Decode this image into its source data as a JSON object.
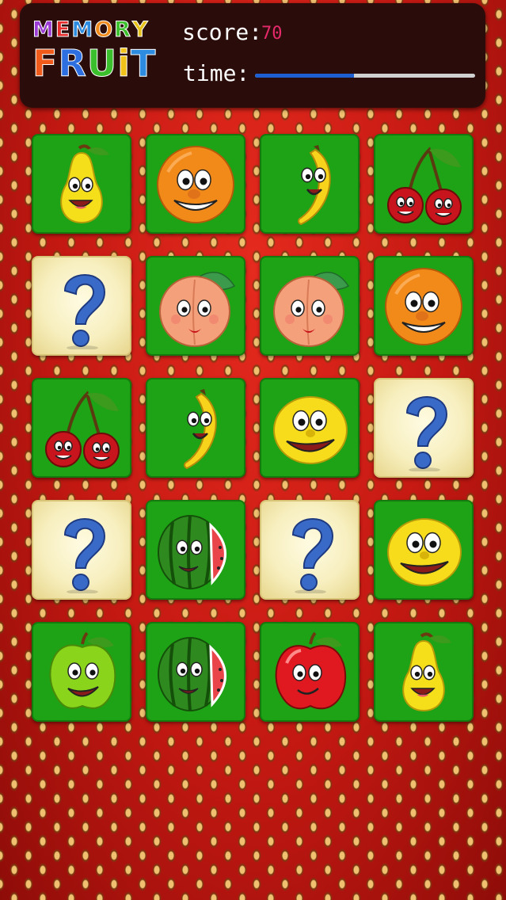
{
  "game": {
    "logo_top_letters": [
      {
        "ch": "M",
        "color": "#9b3ad4"
      },
      {
        "ch": "E",
        "color": "#e62e2e"
      },
      {
        "ch": "M",
        "color": "#2d8be0"
      },
      {
        "ch": "O",
        "color": "#f08a1a"
      },
      {
        "ch": "R",
        "color": "#3cbf2c"
      },
      {
        "ch": "Y",
        "color": "#e6c21a"
      }
    ],
    "logo_bottom_letters": [
      {
        "ch": "F",
        "color": "#f05a1a"
      },
      {
        "ch": "R",
        "color": "#2d6fe0"
      },
      {
        "ch": "U",
        "color": "#3cbf2c"
      },
      {
        "ch": "i",
        "color": "#f0c21a"
      },
      {
        "ch": "T",
        "color": "#2d8be0"
      }
    ]
  },
  "hud": {
    "score_label": "score:",
    "score_value": "70",
    "time_label": "time:",
    "time_remaining": 0.45,
    "time_color": "#1d5fd0"
  },
  "board": {
    "rows": 5,
    "cols": 4,
    "cards": [
      {
        "state": "revealed",
        "fruit": "pear"
      },
      {
        "state": "revealed",
        "fruit": "orange"
      },
      {
        "state": "revealed",
        "fruit": "banana"
      },
      {
        "state": "revealed",
        "fruit": "cherries"
      },
      {
        "state": "hidden",
        "fruit": "question-mark"
      },
      {
        "state": "revealed",
        "fruit": "peach"
      },
      {
        "state": "revealed",
        "fruit": "peach"
      },
      {
        "state": "revealed",
        "fruit": "orange"
      },
      {
        "state": "revealed",
        "fruit": "cherries"
      },
      {
        "state": "revealed",
        "fruit": "banana"
      },
      {
        "state": "revealed",
        "fruit": "lemon"
      },
      {
        "state": "hidden",
        "fruit": "question-mark"
      },
      {
        "state": "hidden",
        "fruit": "question-mark"
      },
      {
        "state": "revealed",
        "fruit": "watermelon"
      },
      {
        "state": "hidden",
        "fruit": "question-mark"
      },
      {
        "state": "revealed",
        "fruit": "lemon"
      },
      {
        "state": "revealed",
        "fruit": "green-apple"
      },
      {
        "state": "revealed",
        "fruit": "watermelon"
      },
      {
        "state": "revealed",
        "fruit": "red-apple"
      },
      {
        "state": "revealed",
        "fruit": "pear"
      }
    ]
  }
}
